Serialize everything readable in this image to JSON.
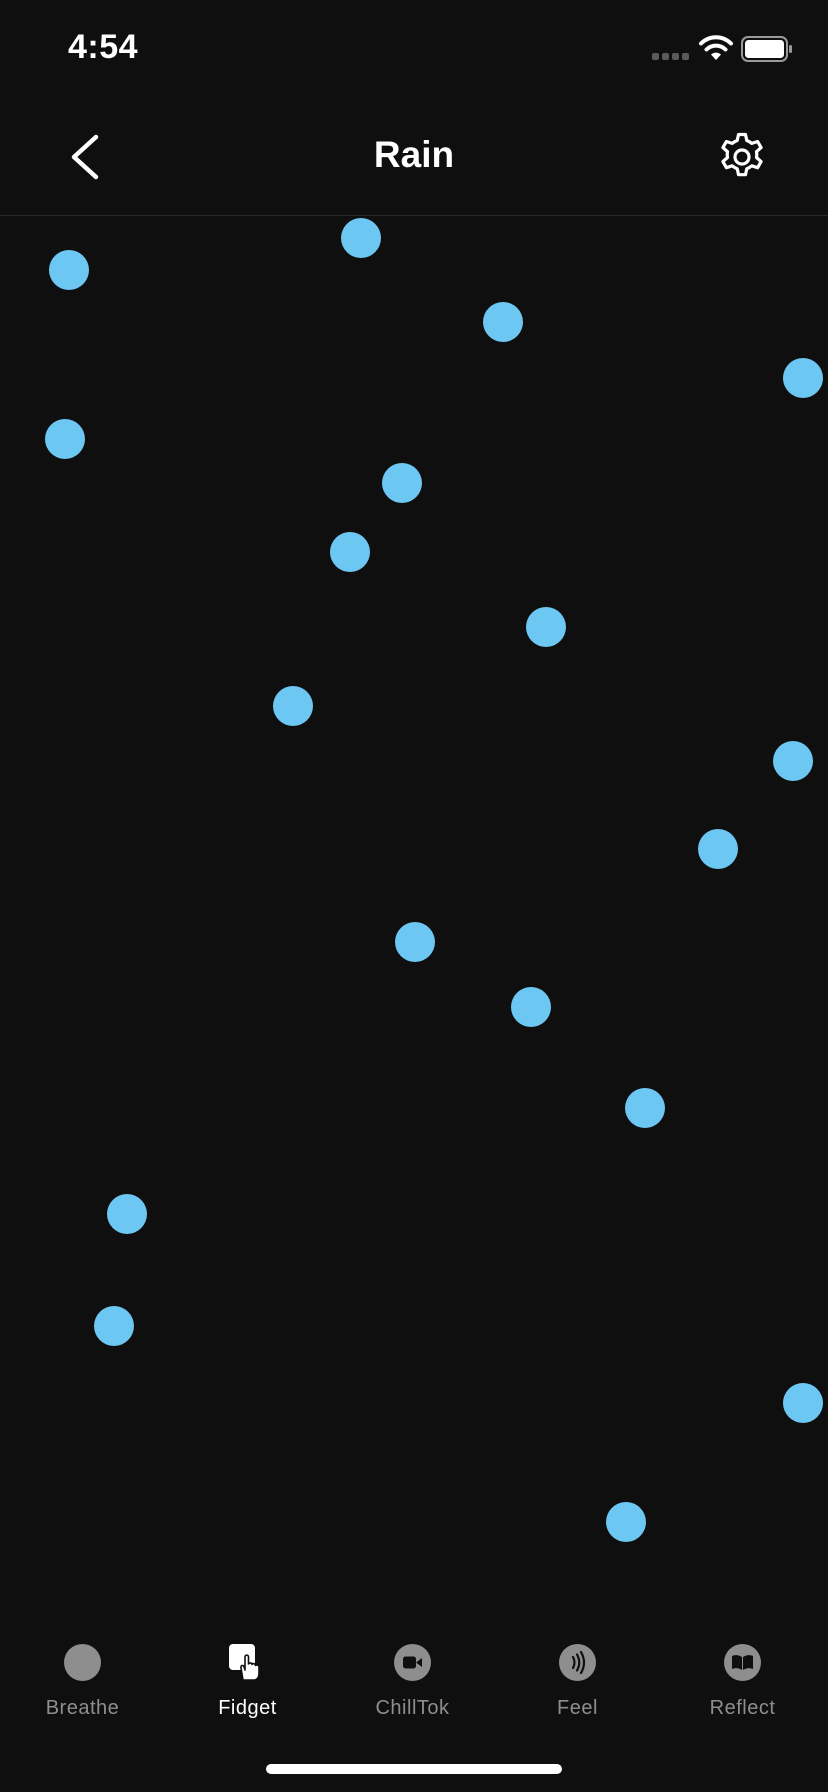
{
  "status_bar": {
    "time": "4:54"
  },
  "header": {
    "title": "Rain",
    "back_icon": "chevron-left-icon",
    "settings_icon": "gear-icon"
  },
  "colors": {
    "background": "#0f0f0f",
    "drop": "#6cc8f3",
    "tab_active": "#ffffff",
    "tab_inactive": "#8e8e8e"
  },
  "tabs": [
    {
      "label": "Breathe",
      "icon": "circle-icon",
      "active": false
    },
    {
      "label": "Fidget",
      "icon": "tap-hand-icon",
      "active": true
    },
    {
      "label": "ChillTok",
      "icon": "video-camera-icon",
      "active": false
    },
    {
      "label": "Feel",
      "icon": "vibration-waves-icon",
      "active": false
    },
    {
      "label": "Reflect",
      "icon": "open-book-icon",
      "active": false
    }
  ]
}
